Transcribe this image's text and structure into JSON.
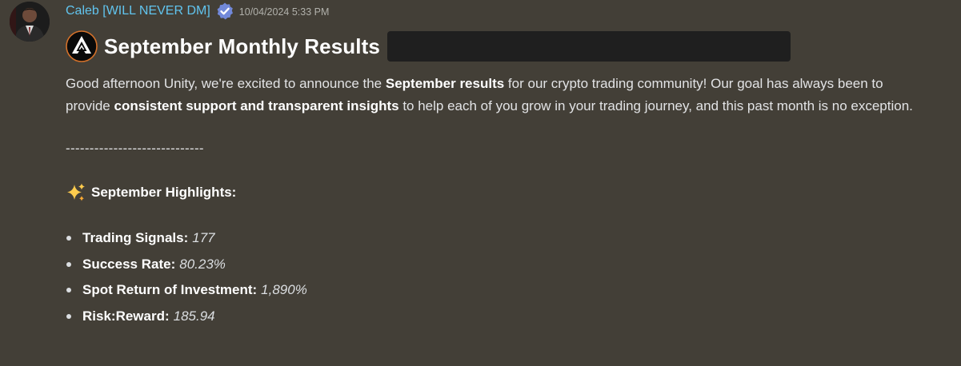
{
  "author": {
    "name": "Caleb [WILL NEVER DM]",
    "timestamp": "10/04/2024 5:33 PM"
  },
  "colors": {
    "background": "#433f37",
    "username": "#61c4ee",
    "verified_badge": "#5865f2",
    "spoiler": "#1f1f1f"
  },
  "post": {
    "title": "September Monthly Results",
    "intro": {
      "p1": "Good afternoon Unity, we're excited to announce the ",
      "b1": "September results",
      "p2": " for our crypto trading community! Our goal has always been to provide ",
      "b2": "consistent support and transparent insights",
      "p3": " to help each of you grow in your trading journey, and this past month is no exception."
    },
    "divider": "-----------------------------",
    "highlights_heading": "September Highlights:",
    "stats": [
      {
        "label": "Trading Signals:",
        "value": "177"
      },
      {
        "label": "Success Rate:",
        "value": "80.23%"
      },
      {
        "label": "Spot Return of Investment:",
        "value": "1,890%"
      },
      {
        "label": "Risk:Reward:",
        "value": "185.94"
      }
    ]
  },
  "icons": {
    "avatar": "user-avatar",
    "verified": "verified-badge-icon",
    "brand": "unity-logo-icon",
    "sparkle": "sparkles-emoji-icon"
  }
}
